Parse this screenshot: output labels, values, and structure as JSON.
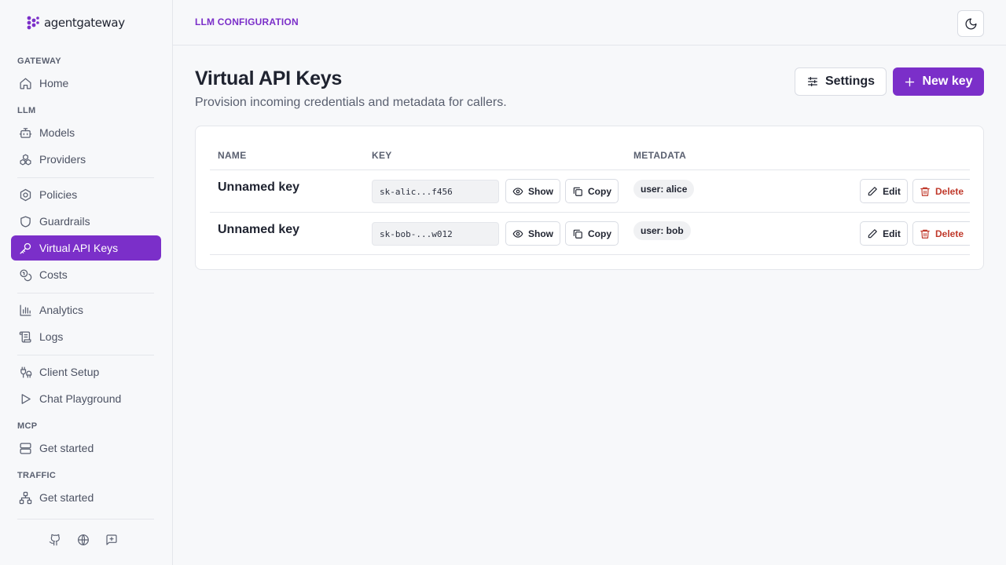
{
  "brand": {
    "name": "agentgateway"
  },
  "sidebar": {
    "sections": {
      "gateway": "GATEWAY",
      "llm": "LLM",
      "mcp": "MCP",
      "traffic": "TRAFFIC"
    },
    "items": {
      "home": "Home",
      "models": "Models",
      "providers": "Providers",
      "policies": "Policies",
      "guardrails": "Guardrails",
      "virtual_api_keys": "Virtual API Keys",
      "costs": "Costs",
      "analytics": "Analytics",
      "logs": "Logs",
      "client_setup": "Client Setup",
      "chat_playground": "Chat Playground",
      "mcp_get_started": "Get started",
      "traffic_get_started": "Get started"
    },
    "active_item": "virtual_api_keys",
    "accent_color": "#7b2fc9",
    "footer_icons": [
      "github-icon",
      "globe-icon",
      "feedback-icon"
    ]
  },
  "header": {
    "breadcrumb": "LLM CONFIGURATION",
    "theme_toggle_icon": "moon-icon"
  },
  "main": {
    "title": "Virtual API Keys",
    "subtitle": "Provision incoming credentials and metadata for callers.",
    "settings_label": "Settings",
    "new_key_label": "New key",
    "table": {
      "columns": [
        "NAME",
        "KEY",
        "METADATA"
      ],
      "rows": [
        {
          "name": "Unnamed key",
          "key": "sk-alic...f456",
          "metadata": "user: alice"
        },
        {
          "name": "Unnamed key",
          "key": "sk-bob-...w012",
          "metadata": "user: bob"
        }
      ],
      "actions": {
        "show": "Show",
        "copy": "Copy",
        "edit": "Edit",
        "delete": "Delete"
      }
    }
  }
}
